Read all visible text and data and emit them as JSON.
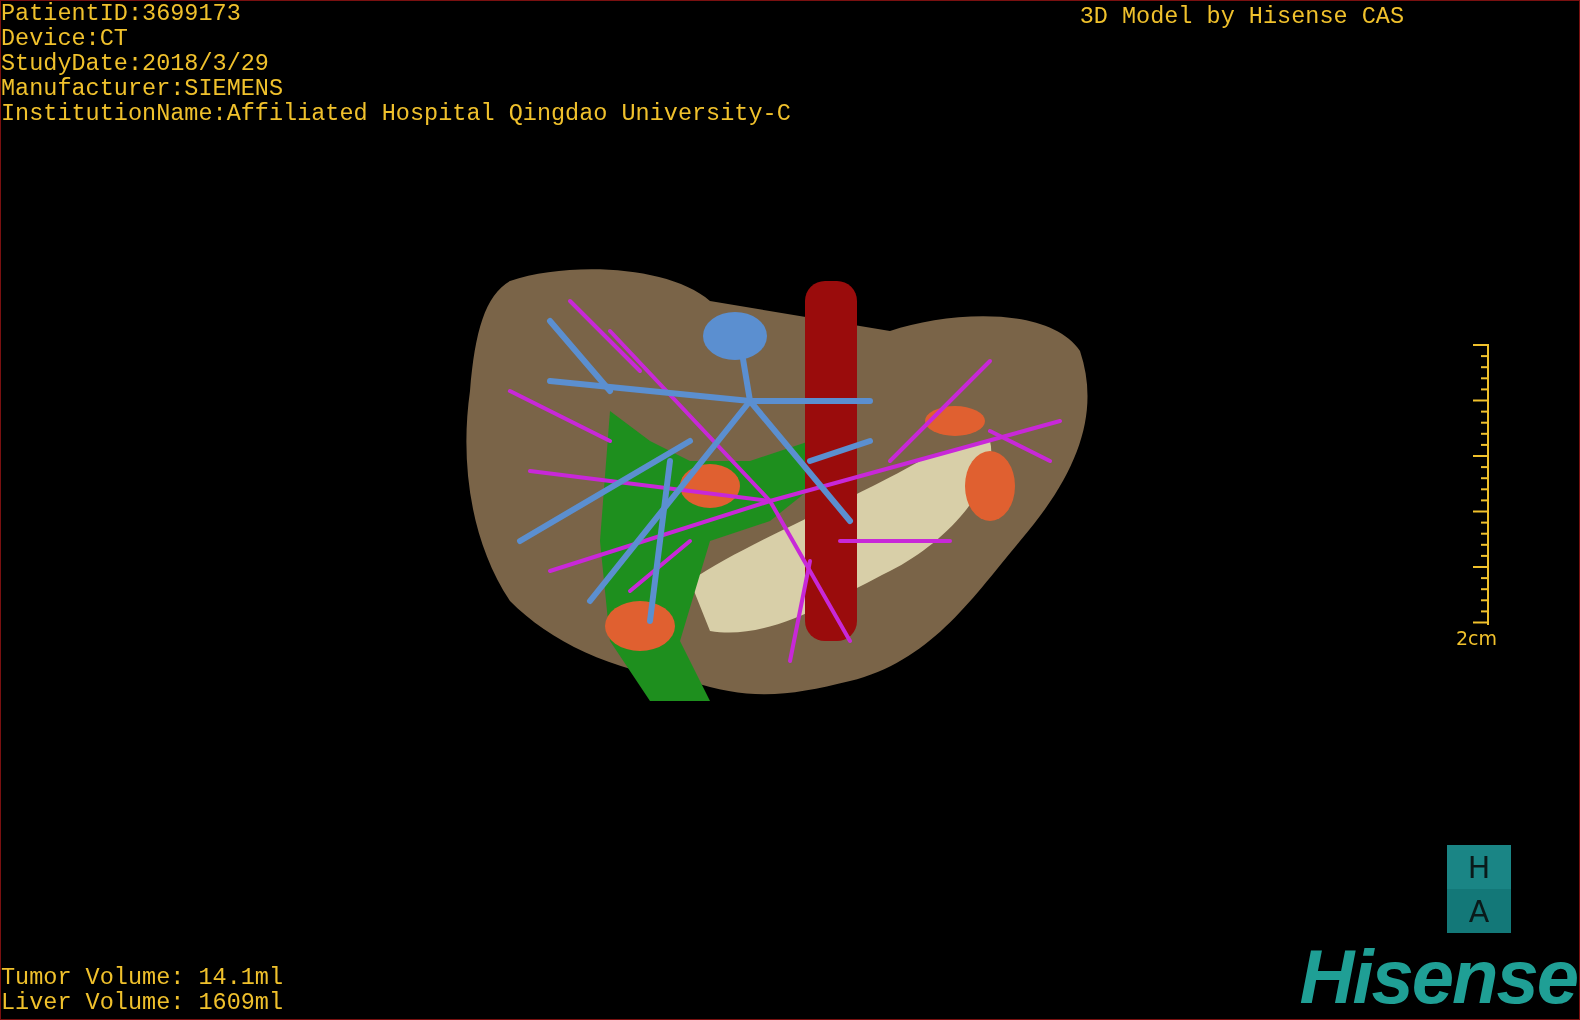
{
  "patient_info": [
    "PatientID:3699173",
    "Device:CT",
    "StudyDate:2018/3/29",
    "Manufacturer:SIEMENS",
    "InstitutionName:Affiliated Hospital Qingdao University-C"
  ],
  "title": "3D Model by Hisense CAS",
  "scale": {
    "label": "2cm"
  },
  "volumes": [
    "Tumor Volume: 14.1ml",
    "Liver Volume: 1609ml"
  ],
  "orientation": {
    "top": "H",
    "bottom": "A"
  },
  "logo": "Hisense"
}
